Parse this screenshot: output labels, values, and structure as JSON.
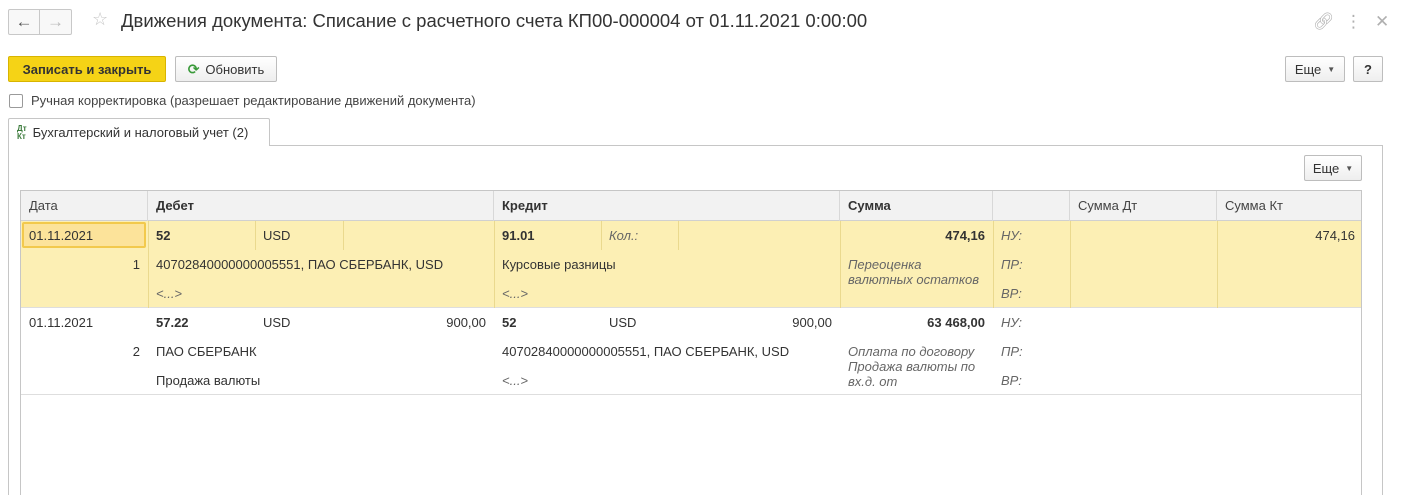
{
  "window": {
    "title": "Движения документа: Списание с расчетного счета КП00-000004 от 01.11.2021 0:00:00",
    "back_icon": "arrow-left-icon",
    "forward_icon": "arrow-right-icon"
  },
  "toolbar": {
    "save_close_label": "Записать и закрыть",
    "refresh_label": "Обновить",
    "more_label": "Еще",
    "help_label": "?"
  },
  "manual_correction": {
    "label": "Ручная корректировка (разрешает редактирование движений документа)",
    "checked": false
  },
  "tabs": [
    {
      "icon_top": "Дт",
      "icon_bottom": "Кт",
      "label": "Бухгалтерский и налоговый учет (2)",
      "active": true
    }
  ],
  "grid": {
    "more_label": "Еще",
    "columns": {
      "date": "Дата",
      "debit": "Дебет",
      "credit": "Кредит",
      "amount": "Сумма",
      "amount_dt": "Сумма Дт",
      "amount_kt": "Сумма Кт"
    },
    "rows": [
      {
        "date": "01.11.2021",
        "num": "1",
        "debit_account": "52",
        "debit_currency": "USD",
        "debit_cur_amount": "",
        "debit_sub1": "40702840000000005551, ПАО СБЕРБАНК, USD",
        "debit_sub2": "<...>",
        "credit_account": "91.01",
        "credit_currency": "Кол.:",
        "credit_cur_amount": "",
        "credit_sub1": "Курсовые разницы",
        "credit_sub2": "<...>",
        "amount": "474,16",
        "content": "Переоценка валютных остатков",
        "nu_label": "НУ:",
        "pr_label": "ПР:",
        "vr_label": "ВР:",
        "amount_dt": "",
        "amount_kt": "474,16"
      },
      {
        "date": "01.11.2021",
        "num": "2",
        "debit_account": "57.22",
        "debit_currency": "USD",
        "debit_cur_amount": "900,00",
        "debit_sub1": "ПАО СБЕРБАНК",
        "debit_sub2": "Продажа валюты",
        "credit_account": "52",
        "credit_currency": "USD",
        "credit_cur_amount": "900,00",
        "credit_sub1": "40702840000000005551, ПАО СБЕРБАНК, USD",
        "credit_sub2": "<...>",
        "amount": "63 468,00",
        "content": "Оплата по договору Продажа валюты по вх.д. от",
        "nu_label": "НУ:",
        "pr_label": "ПР:",
        "vr_label": "ВР:",
        "amount_dt": "",
        "amount_kt": ""
      }
    ]
  },
  "colors": {
    "primary_button": "#f5d316",
    "selected_row": "#fcefb4",
    "header_bg": "#f2f2f2"
  }
}
